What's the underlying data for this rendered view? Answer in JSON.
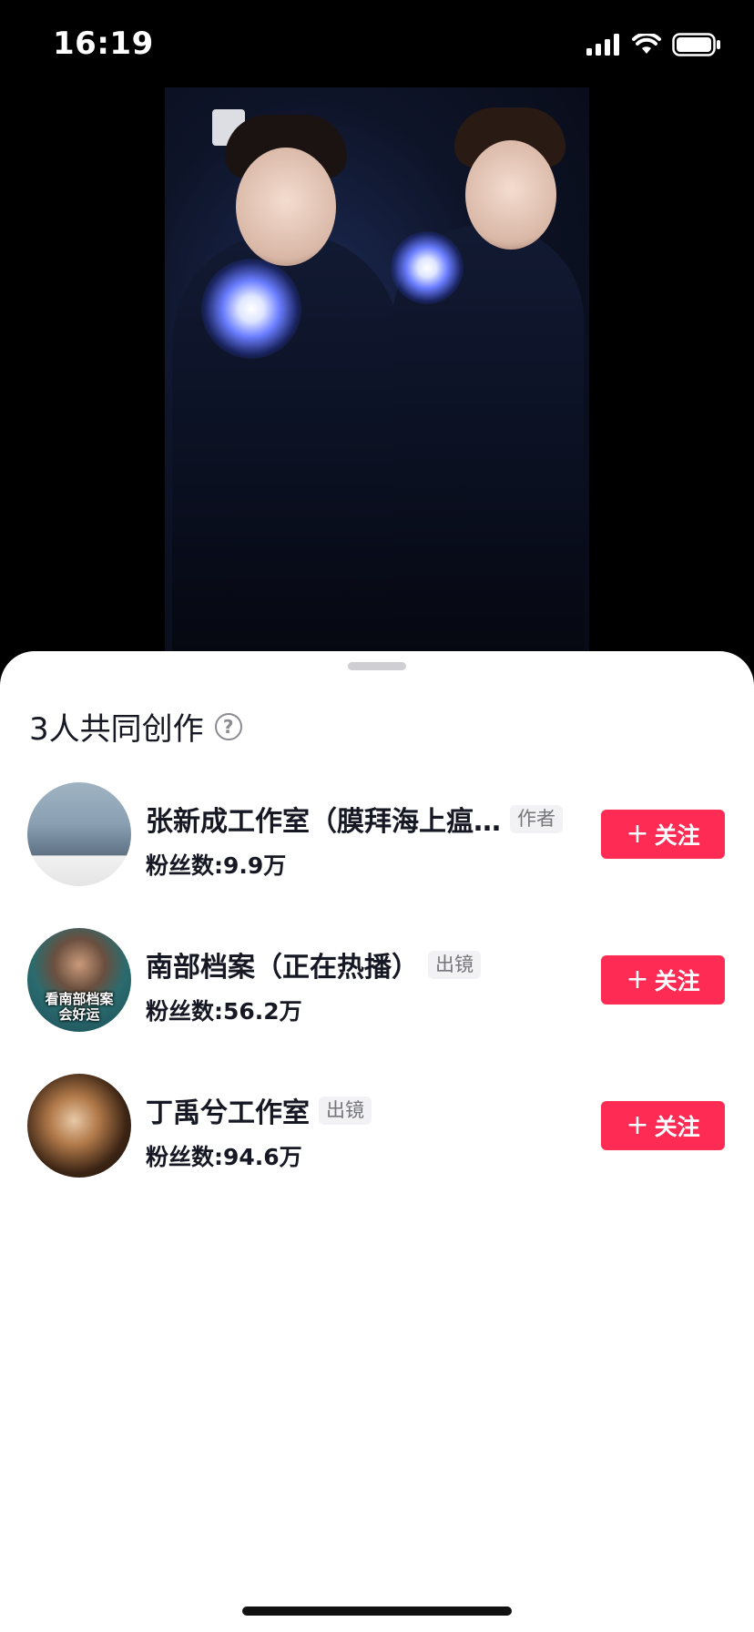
{
  "status_bar": {
    "time": "16:19"
  },
  "sheet": {
    "title": "3人共同创作",
    "help_icon": "question-icon",
    "help_symbol": "?"
  },
  "creators": [
    {
      "name": "张新成工作室（膜拜海上瘟…",
      "tag": "作者",
      "fans": "粉丝数:9.9万",
      "follow_label": "关注",
      "avatar_caption": ""
    },
    {
      "name": "南部档案（正在热播）",
      "tag": "出镜",
      "fans": "粉丝数:56.2万",
      "follow_label": "关注",
      "avatar_caption": "看南部档案\n会好运"
    },
    {
      "name": "丁禹兮工作室",
      "tag": "出镜",
      "fans": "粉丝数:94.6万",
      "follow_label": "关注",
      "avatar_caption": ""
    }
  ],
  "follow_button": {
    "plus_symbol": "+"
  },
  "colors": {
    "accent": "#fe2c55",
    "text_primary": "#161823",
    "tag_text": "#75767c",
    "tag_bg": "#f2f2f4"
  }
}
